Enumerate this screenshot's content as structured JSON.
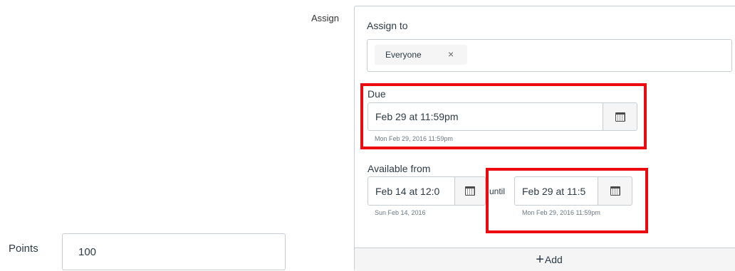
{
  "assign": {
    "section_label": "Assign",
    "assign_to_label": "Assign to",
    "tokens": [
      {
        "label": "Everyone",
        "remove_icon": "×"
      }
    ],
    "due": {
      "label": "Due",
      "value": "Feb 29 at 11:59pm",
      "hint": "Mon Feb 29, 2016 11:59pm"
    },
    "available_from": {
      "label": "Available from",
      "value": "Feb 14 at 12:0",
      "hint": "Sun Feb 14, 2016"
    },
    "until": {
      "label": "until",
      "value": "Feb 29 at 11:5",
      "hint": "Mon Feb 29, 2016 11:59pm"
    },
    "add_plus": "+",
    "add_label": "Add"
  },
  "points": {
    "label": "Points",
    "value": "100"
  },
  "icons": {
    "calendar": "calendar-icon",
    "close": "close-icon",
    "plus": "plus-icon"
  },
  "colors": {
    "highlight": "#ea0a10",
    "border": "#c7cdd1",
    "button_bg": "#f5f5f5",
    "text": "#2d3b45"
  }
}
